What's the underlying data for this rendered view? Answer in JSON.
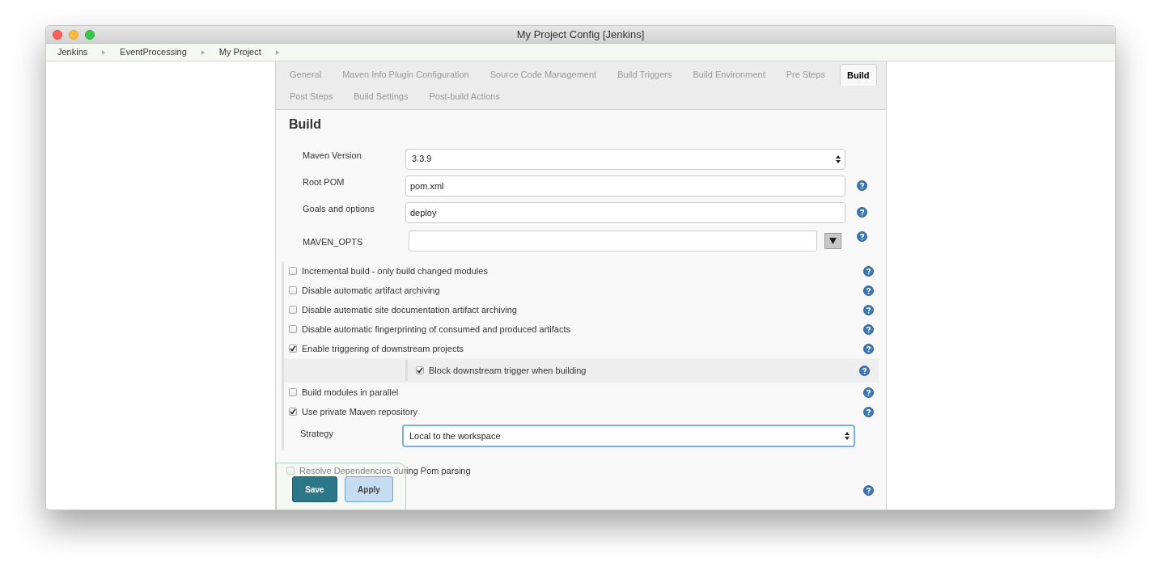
{
  "window": {
    "title": "My Project Config [Jenkins]"
  },
  "breadcrumbs": [
    "Jenkins",
    "EventProcessing",
    "My Project"
  ],
  "tabs": [
    {
      "label": "General",
      "selected": false
    },
    {
      "label": "Maven Info Plugin Configuration",
      "selected": false
    },
    {
      "label": "Source Code Management",
      "selected": false
    },
    {
      "label": "Build Triggers",
      "selected": false
    },
    {
      "label": "Build Environment",
      "selected": false
    },
    {
      "label": "Pre Steps",
      "selected": false
    },
    {
      "label": "Build",
      "selected": true
    },
    {
      "label": "Post Steps",
      "selected": false
    },
    {
      "label": "Build Settings",
      "selected": false
    },
    {
      "label": "Post-build Actions",
      "selected": false
    }
  ],
  "section": {
    "title": "Build"
  },
  "fields": [
    {
      "kind": "select",
      "label": "Maven Version",
      "value": "3.3.9",
      "help": false
    },
    {
      "kind": "text",
      "label": "Root POM",
      "value": "pom.xml",
      "help": true
    },
    {
      "kind": "text",
      "label": "Goals and options",
      "value": "deploy",
      "help": true
    },
    {
      "kind": "expandable",
      "label": "MAVEN_OPTS",
      "help": true
    }
  ],
  "options": [
    {
      "kind": "checkbox",
      "label": "Incremental build - only build changed modules",
      "checked": false,
      "help": true
    },
    {
      "kind": "checkbox",
      "label": "Disable automatic artifact archiving",
      "checked": false,
      "help": true
    },
    {
      "kind": "checkbox",
      "label": "Disable automatic site documentation artifact archiving",
      "checked": false,
      "help": true
    },
    {
      "kind": "checkbox",
      "label": "Disable automatic fingerprinting of consumed and produced artifacts",
      "checked": false,
      "help": true
    },
    {
      "kind": "checkbox",
      "label": "Enable triggering of downstream projects",
      "checked": true,
      "help": true,
      "children": [
        {
          "kind": "checkbox",
          "label": "Block downstream trigger when building",
          "checked": true,
          "help": true
        }
      ]
    },
    {
      "kind": "checkbox",
      "label": "Build modules in parallel",
      "checked": false,
      "help": true
    },
    {
      "kind": "checkbox",
      "label": "Use private Maven repository",
      "checked": true,
      "help": true,
      "children": [
        {
          "kind": "select",
          "label": "Strategy",
          "value": "Local to the workspace",
          "focused": true,
          "help": false
        }
      ]
    }
  ],
  "more_options": [
    {
      "kind": "checkbox",
      "label": "Resolve Dependencies during Pom parsing",
      "checked": false,
      "help": false
    },
    {
      "kind": "hidden",
      "help": true
    }
  ],
  "save_bar": {
    "buttons": [
      {
        "label": "Save",
        "kind": "primary"
      },
      {
        "label": "Apply",
        "kind": "secondary"
      }
    ]
  }
}
